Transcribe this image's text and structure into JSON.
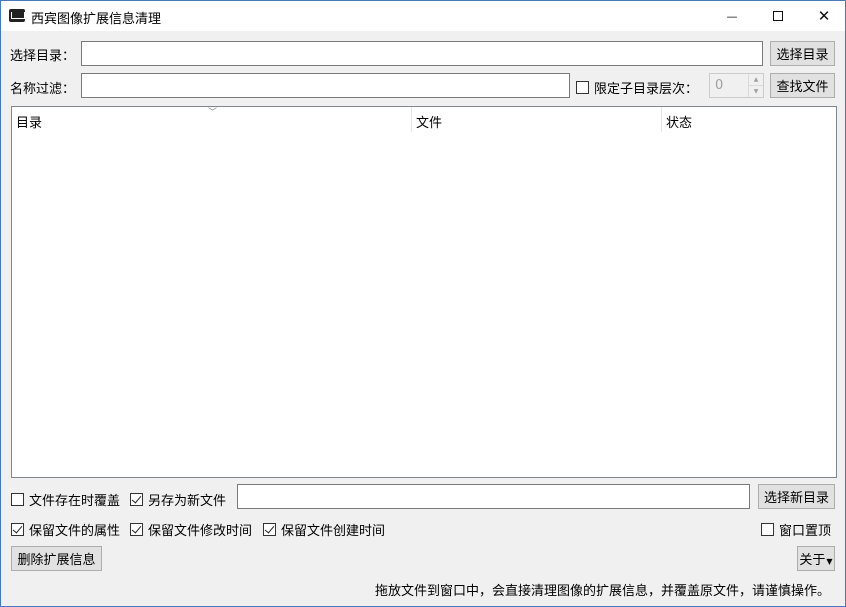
{
  "window": {
    "title": "西宾图像扩展信息清理",
    "min_symbol": "—",
    "close_symbol": "✕"
  },
  "dir_row": {
    "label": "选择目录：",
    "value": "",
    "button": "选择目录"
  },
  "filter_row": {
    "label": "名称过滤：",
    "value": "",
    "limit_checkbox": {
      "label": "限定子目录层次：",
      "checked": false
    },
    "depth_value": "0",
    "button": "查找文件"
  },
  "list": {
    "columns": [
      "目录",
      "文件",
      "状态"
    ],
    "rows": []
  },
  "options": {
    "overwrite_exists": {
      "label": "文件存在时覆盖",
      "checked": false
    },
    "save_as_new": {
      "label": "另存为新文件",
      "checked": true
    },
    "new_dir_value": "",
    "new_dir_button": "选择新目录",
    "keep_attributes": {
      "label": "保留文件的属性",
      "checked": true
    },
    "keep_modified": {
      "label": "保留文件修改时间",
      "checked": true
    },
    "keep_created": {
      "label": "保留文件创建时间",
      "checked": true
    },
    "topmost": {
      "label": "窗口置顶",
      "checked": false
    }
  },
  "actions": {
    "delete_button": "删除扩展信息",
    "about_button": "关于"
  },
  "status_text": "拖放文件到窗口中，会直接清理图像的扩展信息，并覆盖原文件，请谨慎操作。"
}
